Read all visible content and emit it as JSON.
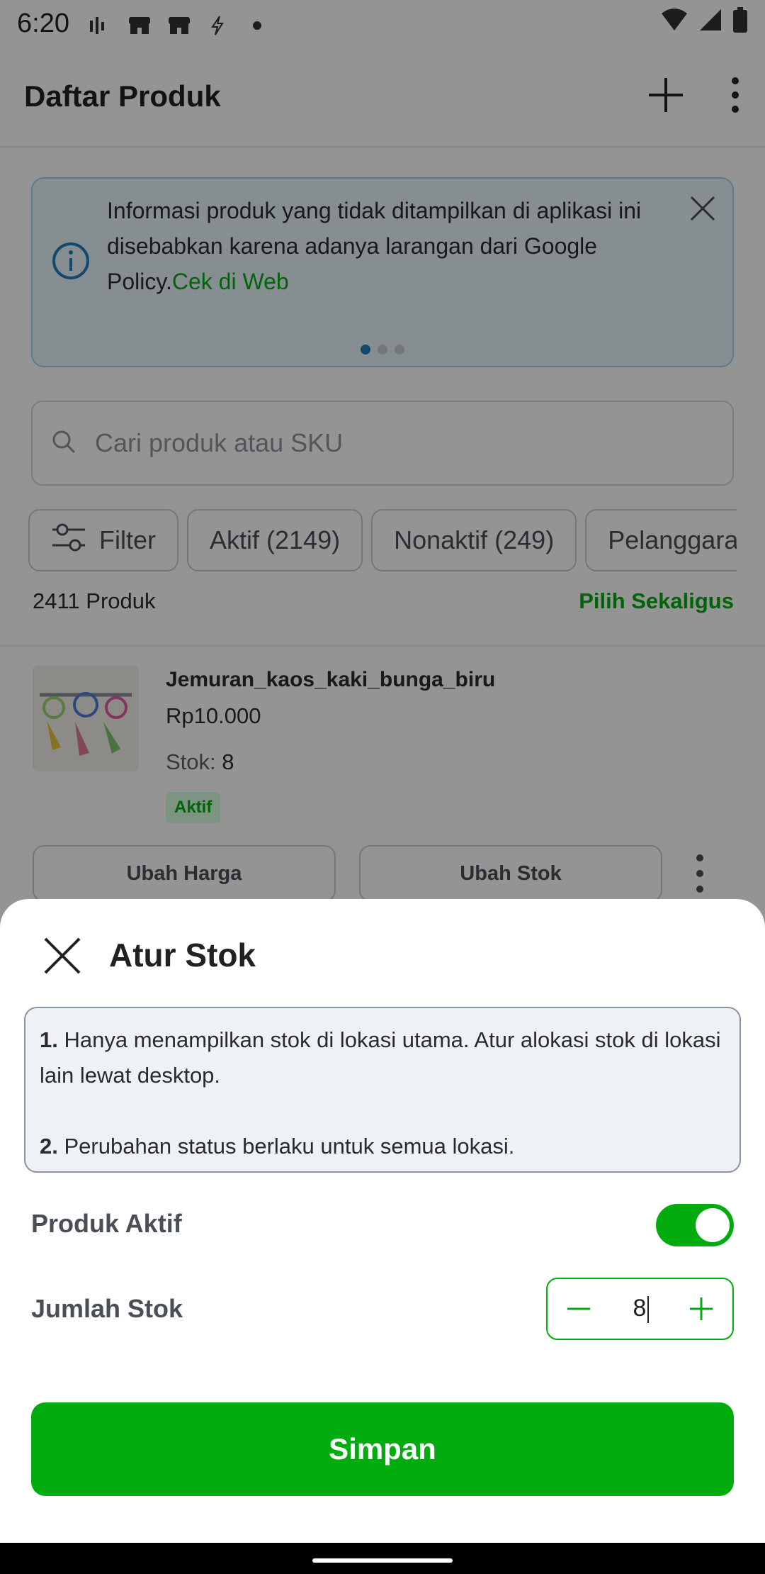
{
  "status_bar": {
    "time": "6:20"
  },
  "app_bar": {
    "title": "Daftar Produk"
  },
  "banner": {
    "text": "Informasi produk yang tidak ditampilkan di aplikasi ini disebabkan karena adanya larangan dari Google Policy.",
    "link": "Cek di Web",
    "page_indicator": {
      "total": 3,
      "active": 1
    }
  },
  "search": {
    "placeholder": "Cari produk atau SKU"
  },
  "filters": {
    "filter_label": "Filter",
    "chips": [
      "Aktif (2149)",
      "Nonaktif (249)",
      "Pelanggaran"
    ]
  },
  "summary": {
    "count": "2411 Produk",
    "select_all": "Pilih Sekaligus"
  },
  "product": {
    "name": "Jemuran_kaos_kaki_bunga_biru",
    "price": "Rp10.000",
    "stock_label": "Stok:",
    "stock_value": "8",
    "status_badge": "Aktif",
    "edit_price_label": "Ubah Harga",
    "edit_stock_label": "Ubah Stok"
  },
  "sheet": {
    "title": "Atur Stok",
    "notes": [
      {
        "num": "1.",
        "text": "Hanya menampilkan stok di lokasi utama. Atur alokasi stok di lokasi lain lewat desktop."
      },
      {
        "num": "2.",
        "text": "Perubahan status berlaku untuk semua lokasi."
      }
    ],
    "active_label": "Produk Aktif",
    "active_on": true,
    "stock_label": "Jumlah Stok",
    "stock_value": "8",
    "save_label": "Simpan"
  },
  "colors": {
    "primary": "#03ac0e",
    "banner_bg": "#e8f4fb",
    "notice_bg": "#eef1f6"
  }
}
